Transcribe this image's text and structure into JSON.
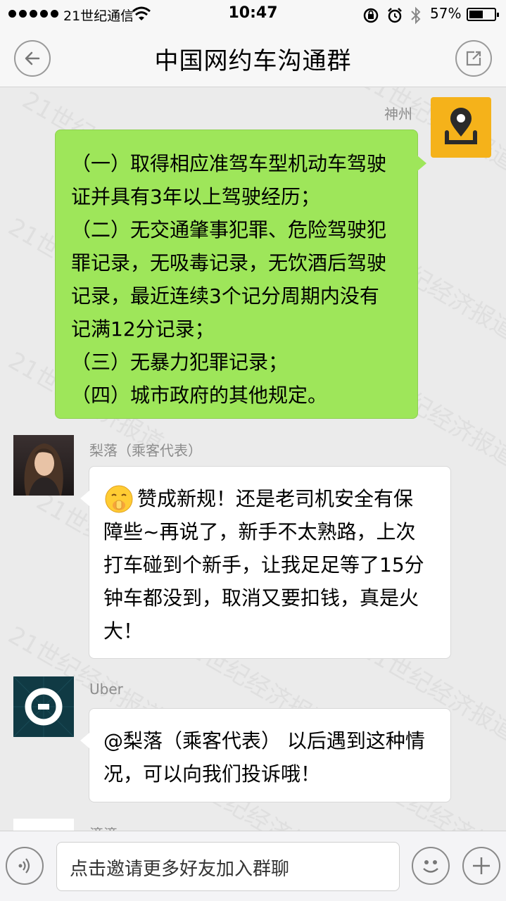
{
  "status_bar": {
    "carrier": "21世纪通信",
    "time": "10:47",
    "battery_percent": "57%",
    "battery_level": 0.57,
    "signal_dots": 5
  },
  "nav": {
    "title": "中国网约车沟通群",
    "back_icon": "back-arrow-icon",
    "share_icon": "share-icon"
  },
  "messages": [
    {
      "sender": "神州",
      "side": "right",
      "lines": [
        "（一）取得相应准驾车型机动车驾驶",
        "证并具有3年以上驾驶经历；",
        "（二）无交通肇事犯罪、危险驾驶犯",
        "罪记录，无吸毒记录，无饮酒后驾驶",
        "记录，最近连续3个记分周期内没有",
        "记满12分记录；",
        "（三）无暴力犯罪记录；",
        "（四）城市政府的其他规定。"
      ]
    },
    {
      "sender": "梨落（乘客代表）",
      "side": "left",
      "lines": [
        "赞成新规！还是老司机安全有保",
        "障些~再说了，新手不太熟路，上次",
        "打车碰到个新手，让我足足等了15分",
        "钟车都没到，取消又要扣钱，真是火",
        "大！"
      ]
    },
    {
      "sender": "Uber",
      "side": "left",
      "lines": [
        "@梨落（乘客代表） 以后遇到这种情",
        "况，可以向我们投诉哦！"
      ]
    },
    {
      "sender": "滴滴",
      "side": "left",
      "lines": []
    }
  ],
  "watermark": "21世纪经济报道",
  "input_bar": {
    "placeholder": "点击邀请更多好友加入群聊",
    "voice_icon": "voice-icon",
    "emoji_icon": "emoji-icon",
    "plus_icon": "plus-icon"
  },
  "colors": {
    "sent_bubble": "#9ee65a",
    "received_bubble": "#ffffff",
    "background": "#ebebeb",
    "shenzhou_avatar": "#f5b21a",
    "uber_avatar": "#103a44"
  }
}
